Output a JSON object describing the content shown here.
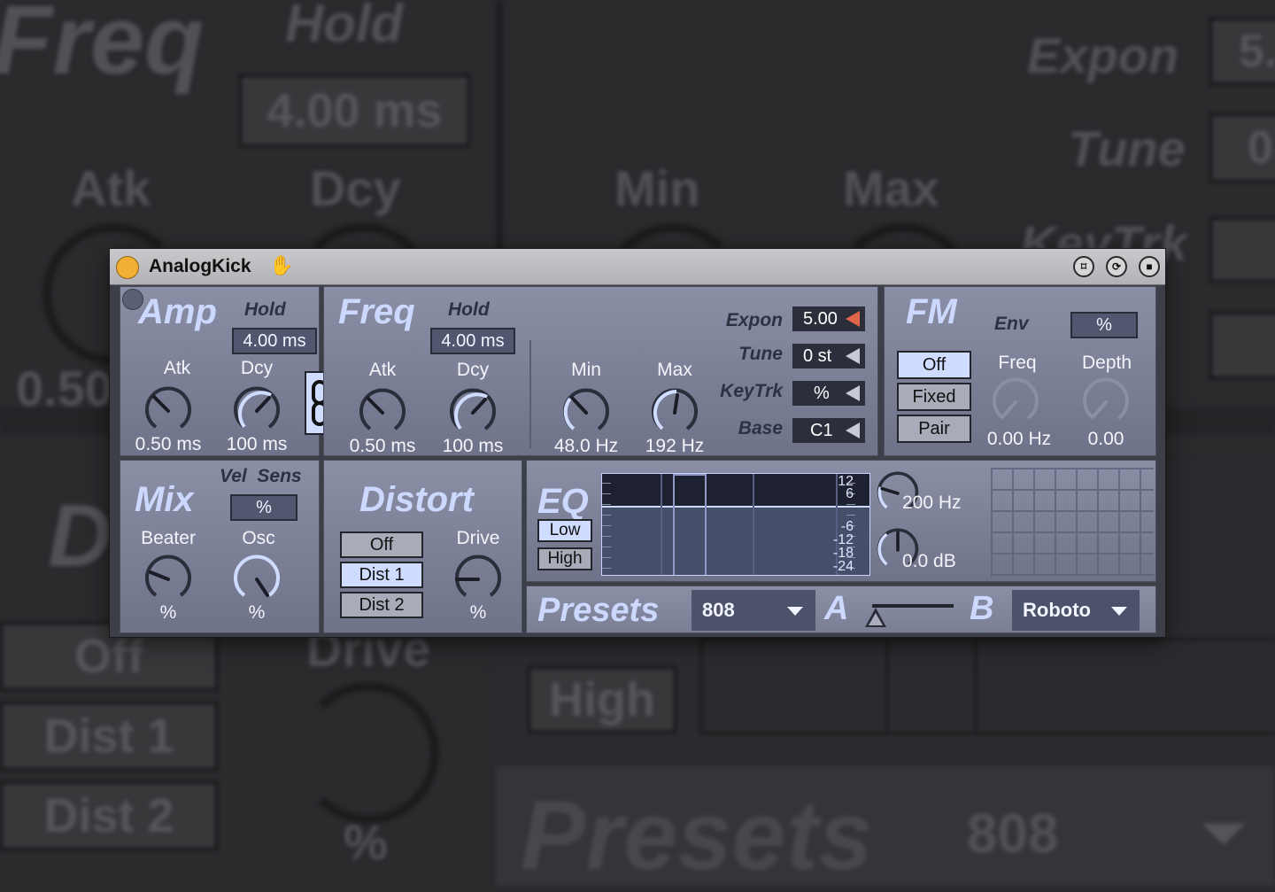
{
  "background": {
    "freq": "Freq",
    "hold": "Hold",
    "hold_value": "4.00 ms",
    "atk": "Atk",
    "dcy": "Dcy",
    "min": "Min",
    "max": "Max",
    "expon": "Expon",
    "expon_value": "5.",
    "tune": "Tune",
    "tune_value": "0",
    "keytrk": "KeyTrk",
    "atk_value": "0.50",
    "dist_partial": "D",
    "off": "Off",
    "dist1": "Dist 1",
    "dist2": "Dist 2",
    "drive": "Drive",
    "pct": "%",
    "high": "High",
    "presets": "Presets",
    "preset_value": "808"
  },
  "device": {
    "title": "AnalogKick",
    "hand_icon": "hand-icon",
    "amp": {
      "heading": "Amp",
      "hold_label": "Hold",
      "hold_value": "4.00 ms",
      "atk_label": "Atk",
      "atk_value": "0.50 ms",
      "dcy_label": "Dcy",
      "dcy_value": "100 ms"
    },
    "freq": {
      "heading": "Freq",
      "hold_label": "Hold",
      "hold_value": "4.00 ms",
      "atk_label": "Atk",
      "atk_value": "0.50 ms",
      "dcy_label": "Dcy",
      "dcy_value": "100 ms",
      "min_label": "Min",
      "min_value": "48.0 Hz",
      "max_label": "Max",
      "max_value": "192 Hz",
      "expon_label": "Expon",
      "expon_value": "5.00",
      "tune_label": "Tune",
      "tune_value": "0 st",
      "keytrk_label": "KeyTrk",
      "keytrk_value": "%",
      "base_label": "Base",
      "base_value": "C1"
    },
    "fm": {
      "heading": "FM",
      "env_label": "Env",
      "env_value": "%",
      "modes": [
        "Off",
        "Fixed",
        "Pair"
      ],
      "selected_mode": "Off",
      "freq_label": "Freq",
      "freq_value": "0.00 Hz",
      "depth_label": "Depth",
      "depth_value": "0.00"
    },
    "mix": {
      "heading": "Mix",
      "vel_sens_label": "Vel  Sens",
      "vel_sens_value": "%",
      "beater_label": "Beater",
      "beater_value": "%",
      "osc_label": "Osc",
      "osc_value": "%"
    },
    "distort": {
      "heading": "Distort",
      "modes": [
        "Off",
        "Dist 1",
        "Dist 2"
      ],
      "selected_mode": "Dist 1",
      "drive_label": "Drive",
      "drive_value": "%"
    },
    "eq": {
      "heading": "EQ",
      "low_label": "Low",
      "high_label": "High",
      "selected": "Low",
      "scale": [
        "12",
        "6",
        "-6",
        "-12",
        "-18",
        "-24"
      ],
      "freq_value": "200 Hz",
      "gain_value": "0.0 dB"
    },
    "presets": {
      "heading": "Presets",
      "preset_value": "808",
      "a_label": "A",
      "b_label": "B",
      "b_value": "Roboto"
    }
  }
}
